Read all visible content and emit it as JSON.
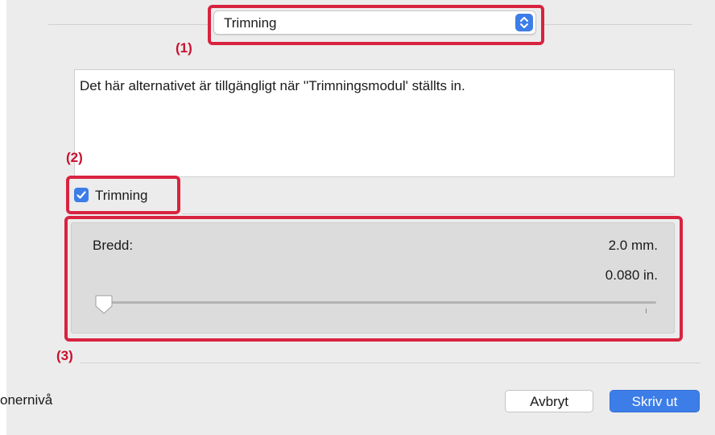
{
  "popup": {
    "selected": "Trimning"
  },
  "callouts": {
    "c1": "(1)",
    "c2": "(2)",
    "c3": "(3)"
  },
  "description": "Det här alternativet är tillgängligt när ''Trimningsmodul' ställts in.",
  "checkbox": {
    "label": "Trimning",
    "checked": true
  },
  "width_group": {
    "label": "Bredd:",
    "value_mm": "2.0 mm.",
    "value_in": "0.080 in.",
    "slider_fraction": 0
  },
  "footer": {
    "left_text": "onernivå",
    "cancel_label": "Avbryt",
    "print_label": "Skriv ut"
  },
  "colors": {
    "accent": "#3d7de8",
    "highlight": "#d8233f",
    "callout": "#c8102e"
  }
}
